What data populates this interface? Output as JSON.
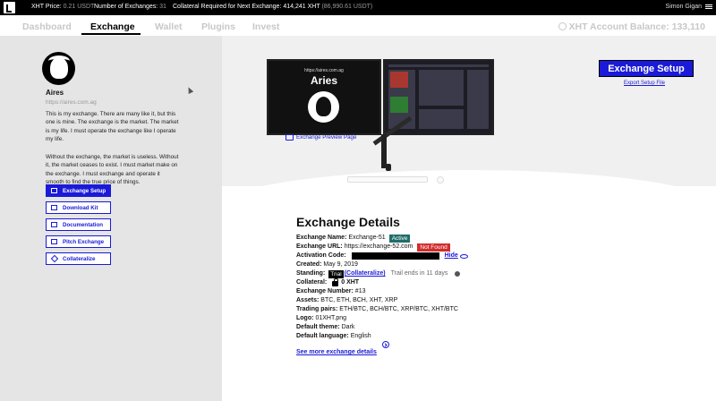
{
  "topbar": {
    "xht_price_label": "XHT Price:",
    "xht_price_value": "0.21 USDT",
    "exchanges_label": "Number of Exchanges:",
    "exchanges_value": "31",
    "collateral_label": "Collateral Required for Next Exchange:",
    "collateral_value": "414,241 XHT",
    "collateral_usdt": "(86,990.61 USDT)",
    "user_name": "Simon Gigan"
  },
  "nav": {
    "tabs": [
      {
        "label": "Dashboard"
      },
      {
        "label": "Exchange"
      },
      {
        "label": "Wallet"
      },
      {
        "label": "Plugins"
      },
      {
        "label": "Invest"
      }
    ],
    "balance_label": "XHT Account Balance: 133,110"
  },
  "sidebar": {
    "name": "Aires",
    "url": "https://aires.com.ag",
    "description_1": "This is my exchange. There are many like it, but this one is mine. The exchange is the market. The market is my life. I must operate the exchange like I operate my life.",
    "description_2": "Without the exchange, the market is useless. Without it, the market ceases to exist. I must market make on the exchange. I must exchange and operate it smooth to find the true price of things.",
    "buttons": [
      {
        "label": "Exchange Setup",
        "icon": "settings-icon"
      },
      {
        "label": "Download Kit",
        "icon": "download-icon"
      },
      {
        "label": "Documentation",
        "icon": "document-icon"
      },
      {
        "label": "Pitch Exchange",
        "icon": "pitch-icon"
      },
      {
        "label": "Collateralize",
        "icon": "diamond-icon"
      }
    ]
  },
  "hero": {
    "monitor_url": "https://aires.com.ag",
    "monitor_title": "Aries",
    "preview_label": "Exchange Preview Page",
    "setup_button": "Exchange Setup",
    "export_link": "Export Setup File"
  },
  "details": {
    "title": "Exchange Details",
    "name_label": "Exchange Name:",
    "name_value": "Exchange-51",
    "status_badge": "Active",
    "url_label": "Exchange URL:",
    "url_value": "https://exchange-52.com",
    "url_status": "Not Found",
    "activation_label": "Activation Code:",
    "hide_label": "Hide",
    "created_label": "Created:",
    "created_value": "May 9, 2019",
    "standing_label": "Standing:",
    "standing_value": "Trial",
    "collateralize_link": "(Collateralize)",
    "trial_note": "Trail ends in 11 days",
    "collateral_label": "Collateral:",
    "collateral_value": "0 XHT",
    "number_label": "Exchange Number:",
    "number_value": "#13",
    "assets_label": "Assets:",
    "assets_value": "BTC, ETH, BCH, XHT, XRP",
    "pairs_label": "Trading pairs:",
    "pairs_value": "ETH/BTC, BCH/BTC, XRP/BTC, XHT/BTC",
    "logo_label": "Logo:",
    "logo_value": "01XHT.png",
    "theme_label": "Default theme:",
    "theme_value": "Dark",
    "language_label": "Default language:",
    "language_value": "English",
    "more_link": "See more exchange details"
  }
}
